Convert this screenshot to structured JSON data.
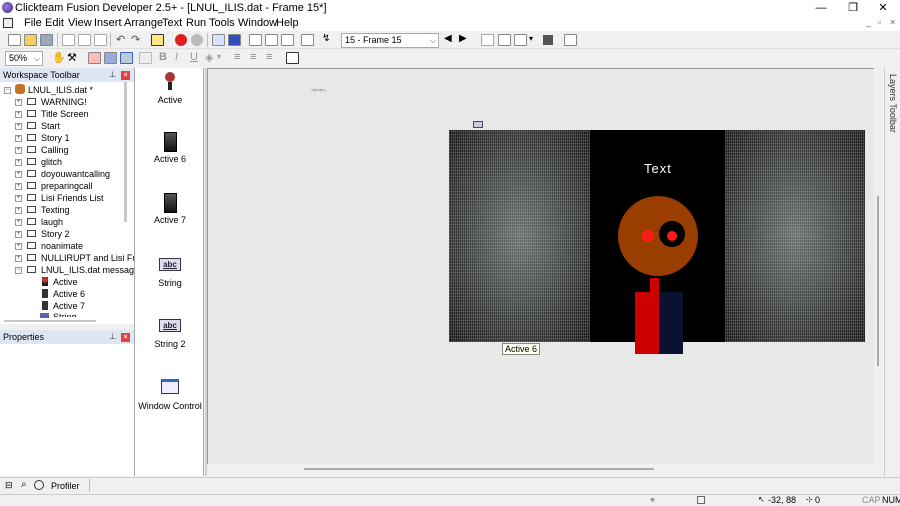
{
  "window": {
    "title": "Clickteam Fusion Developer 2.5+ - [LNUL_ILIS.dat - Frame 15*]",
    "minimize_glyph": "—",
    "maximize_glyph": "❐",
    "close_glyph": "✕"
  },
  "menu": {
    "items": [
      "File",
      "Edit",
      "View",
      "Insert",
      "Arrange",
      "Text",
      "Run",
      "Tools",
      "Window",
      "Help"
    ],
    "mdi_min": "_",
    "mdi_restore": "▫",
    "mdi_close": "×"
  },
  "toolbar": {
    "frame_select": "15 - Frame 15",
    "zoom": "50%"
  },
  "workspace": {
    "title": "Workspace Toolbar",
    "pin_glyph": "⊥",
    "close_glyph": "×",
    "root": "LNUL_ILIS.dat *",
    "frames": [
      "WARNING!",
      "Title Screen",
      "Start",
      "Story 1",
      "Calling",
      "glitch",
      "doyouwantcalling",
      "preparingcall",
      "Lisi Friends List",
      "Texting",
      "laugh",
      "Story 2",
      "noanimate",
      "NULLIRUPT and Lisi Fu",
      "LNUL_ILIS.dat message"
    ],
    "objects": [
      "Active",
      "Active 6",
      "Active 7",
      "String"
    ]
  },
  "properties": {
    "title": "Properties"
  },
  "objects_panel": {
    "items": [
      "Active",
      "Active 6",
      "Active 7",
      "String",
      "String 2",
      "Window Control"
    ],
    "abc": "abc"
  },
  "editor": {
    "small_text": "~≈~≈~.",
    "frame_text": "Text",
    "selected_label": "Active 6"
  },
  "layers": {
    "title": "Layers Toolbar"
  },
  "profiler": {
    "label": "Profiler"
  },
  "status": {
    "coords": "-32, 88",
    "count": "0",
    "caps": "CAP",
    "num": "NUM"
  },
  "colors": {
    "face": "#9a3d00",
    "eye_red": "#ff1a1a",
    "body_red": "#cc0000",
    "body_navy": "#0b1230"
  }
}
